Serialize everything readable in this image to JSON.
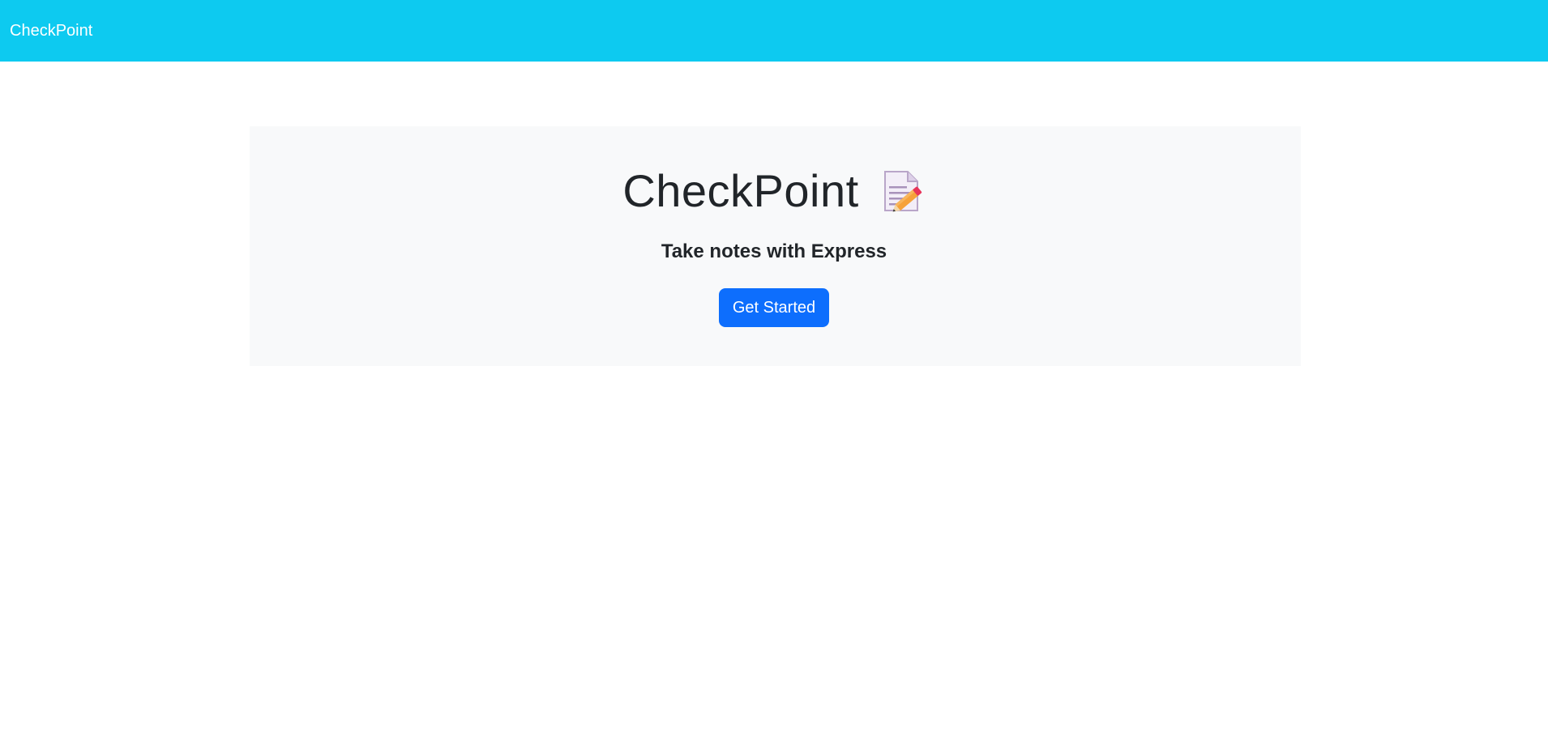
{
  "navbar": {
    "brand": "CheckPoint",
    "background_color": "#0dcaf0"
  },
  "hero": {
    "title": "CheckPoint",
    "title_icon": "memo-icon",
    "tagline": "Take notes with Express",
    "cta_label": "Get Started",
    "cta_color": "#0d6efd",
    "panel_color": "#f8f9fa"
  }
}
